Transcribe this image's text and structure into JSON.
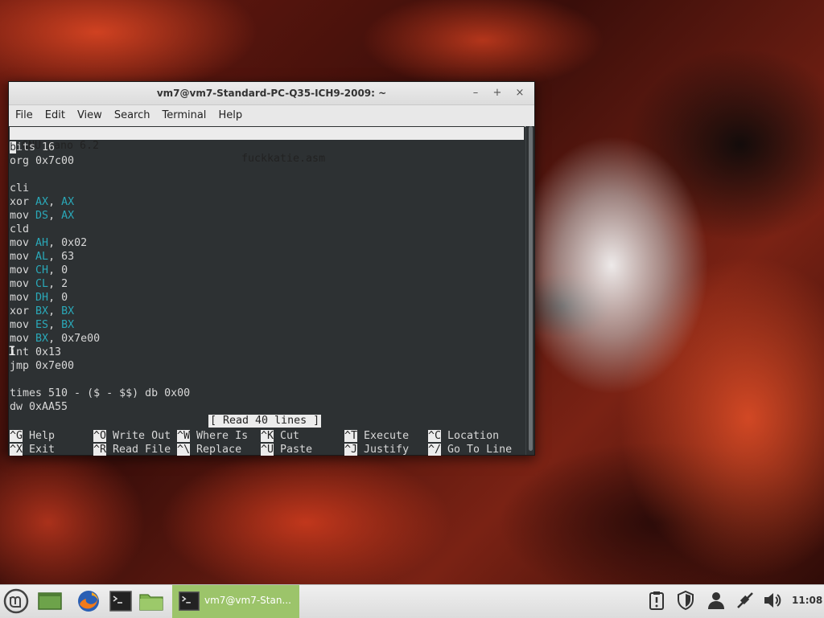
{
  "window": {
    "title": "vm7@vm7-Standard-PC-Q35-ICH9-2009: ~",
    "controls": {
      "minimize": "–",
      "maximize": "+",
      "close": "×"
    }
  },
  "menu": [
    "File",
    "Edit",
    "View",
    "Search",
    "Terminal",
    "Help"
  ],
  "nano": {
    "app": "GNU nano 6.2",
    "filename": "fuckkatie.asm",
    "status": "[ Read 40 lines ]",
    "lines": [
      {
        "text": "bits 16"
      },
      {
        "text": "org 0x7c00"
      },
      {
        "text": ""
      },
      {
        "text": "cli"
      },
      {
        "op": "xor",
        "reg": "AX",
        "arg": "AX",
        "arg_reg": true
      },
      {
        "op": "mov",
        "reg": "DS",
        "arg": "AX",
        "arg_reg": true
      },
      {
        "text": "cld"
      },
      {
        "op": "mov",
        "reg": "AH",
        "arg": "0x02"
      },
      {
        "op": "mov",
        "reg": "AL",
        "arg": "63"
      },
      {
        "op": "mov",
        "reg": "CH",
        "arg": "0"
      },
      {
        "op": "mov",
        "reg": "CL",
        "arg": "2"
      },
      {
        "op": "mov",
        "reg": "DH",
        "arg": "0"
      },
      {
        "op": "xor",
        "reg": "BX",
        "arg": "BX",
        "arg_reg": true
      },
      {
        "op": "mov",
        "reg": "ES",
        "arg": "BX",
        "arg_reg": true
      },
      {
        "op": "mov",
        "reg": "BX",
        "arg": "0x7e00"
      },
      {
        "text": "int 0x13"
      },
      {
        "text": "jmp 0x7e00"
      },
      {
        "text": ""
      },
      {
        "text": "times 510 - ($ - $$) db 0x00"
      },
      {
        "text": "dw 0xAA55"
      }
    ],
    "shortcuts_row1": [
      {
        "key": "^G",
        "label": "Help"
      },
      {
        "key": "^O",
        "label": "Write Out"
      },
      {
        "key": "^W",
        "label": "Where Is"
      },
      {
        "key": "^K",
        "label": "Cut"
      },
      {
        "key": "^T",
        "label": "Execute"
      },
      {
        "key": "^C",
        "label": "Location"
      }
    ],
    "shortcuts_row2": [
      {
        "key": "^X",
        "label": "Exit"
      },
      {
        "key": "^R",
        "label": "Read File"
      },
      {
        "key": "^\\",
        "label": "Replace"
      },
      {
        "key": "^U",
        "label": "Paste"
      },
      {
        "key": "^J",
        "label": "Justify"
      },
      {
        "key": "^/",
        "label": "Go To Line"
      }
    ]
  },
  "taskbar": {
    "active_window": "vm7@vm7-Stan...",
    "clock": "11:08"
  }
}
